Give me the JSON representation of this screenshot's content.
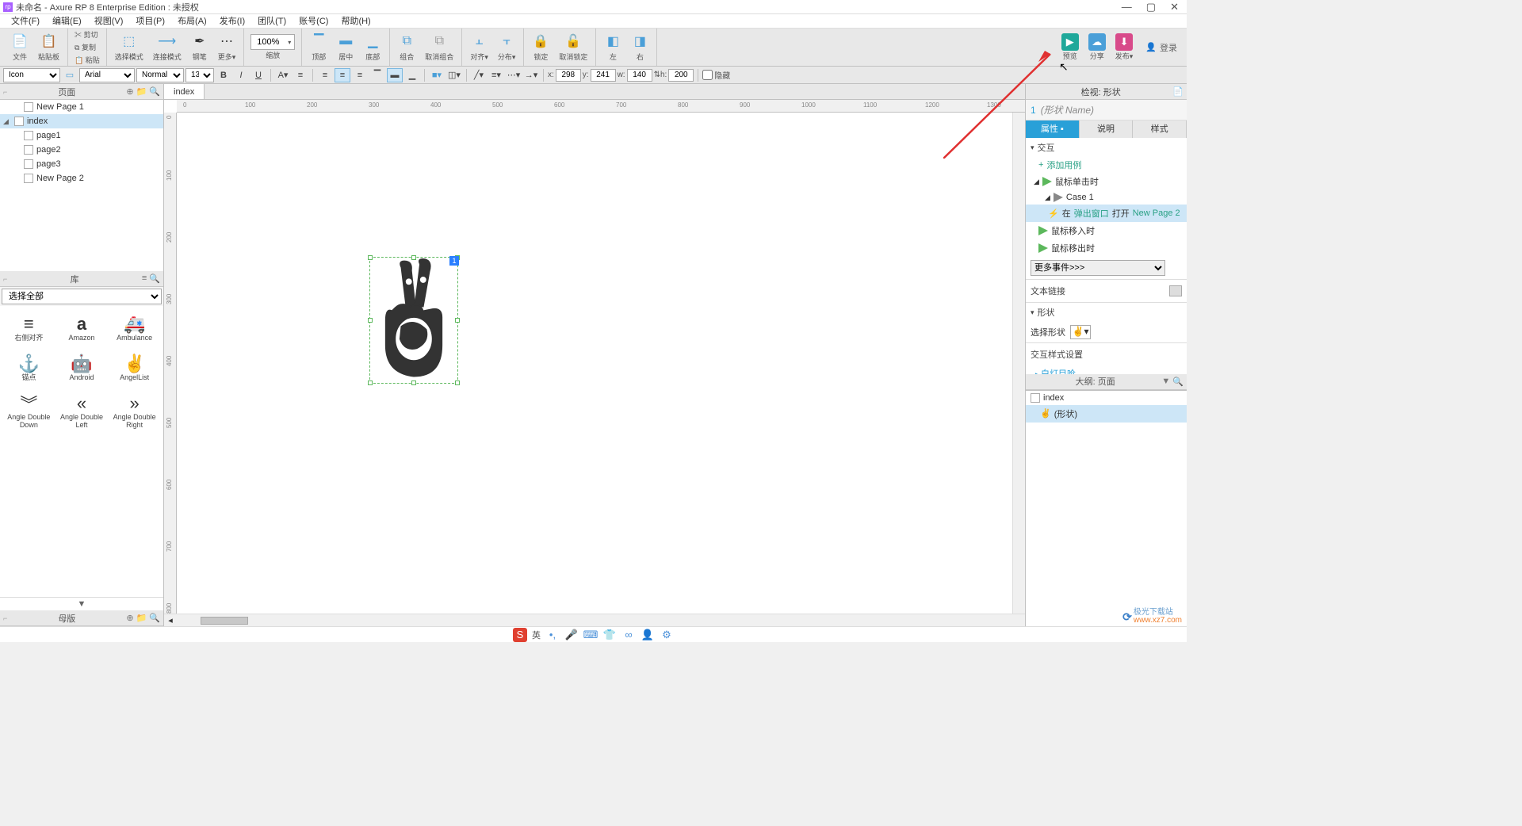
{
  "titlebar": {
    "app_icon": "rp",
    "title": "未命名 - Axure RP 8 Enterprise Edition : 未授权"
  },
  "menubar": [
    "文件(F)",
    "编辑(E)",
    "视图(V)",
    "项目(P)",
    "布局(A)",
    "发布(I)",
    "团队(T)",
    "账号(C)",
    "帮助(H)"
  ],
  "toolbar": {
    "file_group": {
      "open": "文件",
      "paste": "粘贴板"
    },
    "edit_group": {
      "cut": "✂ 剪切",
      "copy": "⧉ 复制",
      "paste": "📋 粘贴"
    },
    "mode_group": {
      "select": "选择模式",
      "connect": "连接模式",
      "pen": "钢笔",
      "more": "更多▾"
    },
    "zoom": {
      "value": "100%",
      "label": "缩放"
    },
    "align_group": {
      "top": "顶部",
      "middle": "居中",
      "bottom": "底部"
    },
    "group_group": {
      "group": "组合",
      "ungroup": "取消组合"
    },
    "align2": {
      "align": "对齐▾",
      "distribute": "分布▾"
    },
    "lock_group": {
      "lock": "锁定",
      "unlock": "取消锁定"
    },
    "lr_group": {
      "left": "左",
      "right": "右"
    },
    "right_buttons": {
      "preview": {
        "label": "预览",
        "color": "#1fa89a"
      },
      "share": {
        "label": "分享",
        "color": "#4a9fd8"
      },
      "publish": {
        "label": "发布▾",
        "color": "#d84a8a"
      }
    },
    "login": "登录"
  },
  "formatbar": {
    "shape_preset": "Icon",
    "font": "Arial",
    "style": "Normal",
    "size": "13",
    "x": "298",
    "y": "241",
    "w": "140",
    "h": "200",
    "hidden": "隐藏"
  },
  "left": {
    "pages_title": "页面",
    "tree": [
      {
        "label": "New Page 1",
        "indent": 0
      },
      {
        "label": "index",
        "indent": 0,
        "expanded": true,
        "selected": true
      },
      {
        "label": "page1",
        "indent": 1
      },
      {
        "label": "page2",
        "indent": 1
      },
      {
        "label": "page3",
        "indent": 1
      },
      {
        "label": "New Page 2",
        "indent": 0
      }
    ],
    "lib_title": "库",
    "lib_select": "选择全部",
    "lib_items": [
      {
        "label": "右侧对齐",
        "icon": "≡"
      },
      {
        "label": "Amazon",
        "icon": "a"
      },
      {
        "label": "Ambulance",
        "icon": "🚑"
      },
      {
        "label": "锚点",
        "icon": "⚓"
      },
      {
        "label": "Android",
        "icon": "🤖"
      },
      {
        "label": "AngelList",
        "icon": "✌"
      },
      {
        "label": "Angle Double Down",
        "icon": "︾"
      },
      {
        "label": "Angle Double Left",
        "icon": "«"
      },
      {
        "label": "Angle Double Right",
        "icon": "»"
      }
    ],
    "master_title": "母版"
  },
  "canvas": {
    "tab": "index",
    "ruler_marks": [
      0,
      100,
      200,
      300,
      400,
      500,
      600,
      700,
      800,
      900,
      1000,
      1100,
      1200,
      1300
    ],
    "ruler_v_marks": [
      0,
      100,
      200,
      300,
      400,
      500,
      600,
      700,
      800
    ],
    "badge": "1"
  },
  "right": {
    "insp_title": "检视: 形状",
    "shape_idx": "1",
    "shape_name": "(形状 Name)",
    "tabs": [
      "属性",
      "说明",
      "样式"
    ],
    "interact": "交互",
    "add_case": "添加用例",
    "events": {
      "click": "鼠标单击时",
      "case1": "Case 1",
      "action_pre": "在 ",
      "action_popup": "弹出窗口",
      "action_open": " 打开 ",
      "action_page": "New Page 2",
      "hover_in": "鼠标移入时",
      "hover_out": "鼠标移出时"
    },
    "more_events": "更多事件>>>",
    "text_link": "文本链接",
    "shape_sect": "形状",
    "select_shape": "选择形状",
    "style_sect": "交互样式设置",
    "sub_item": "白灯目呛",
    "outline_title": "大纲: 页面",
    "outline": [
      {
        "label": "index",
        "selected": false
      },
      {
        "label": "(形状)",
        "selected": true,
        "indent": 1
      }
    ]
  },
  "taskbar": {
    "ime": "英"
  },
  "watermark": {
    "brand": "极光下载站",
    "url": "www.xz7.com"
  }
}
